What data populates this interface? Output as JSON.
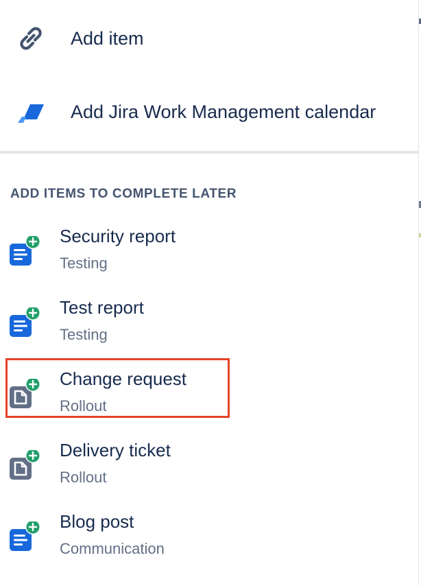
{
  "actions": [
    {
      "label": "Add item",
      "icon": "link-icon"
    },
    {
      "label": "Add Jira Work Management calendar",
      "icon": "jira-work-management-logo-icon"
    }
  ],
  "section": {
    "heading": "ADD ITEMS TO COMPLETE LATER"
  },
  "later_items": [
    {
      "title": "Security report",
      "subtitle": "Testing",
      "icon": "blue-document-add-icon",
      "icon_color": "#1868db"
    },
    {
      "title": "Test report",
      "subtitle": "Testing",
      "icon": "blue-document-add-icon",
      "icon_color": "#1868db"
    },
    {
      "title": "Change request",
      "subtitle": "Rollout",
      "icon": "gray-file-add-icon",
      "icon_color": "#626f86"
    },
    {
      "title": "Delivery ticket",
      "subtitle": "Rollout",
      "icon": "gray-file-add-icon",
      "icon_color": "#626f86"
    },
    {
      "title": "Blog post",
      "subtitle": "Communication",
      "icon": "blue-document-add-icon",
      "icon_color": "#1868db"
    }
  ],
  "colors": {
    "text": "#172b4d",
    "subtext": "#626f86",
    "heading": "#44546f",
    "add_badge": "#22a06b",
    "highlight": "#e5432a"
  }
}
